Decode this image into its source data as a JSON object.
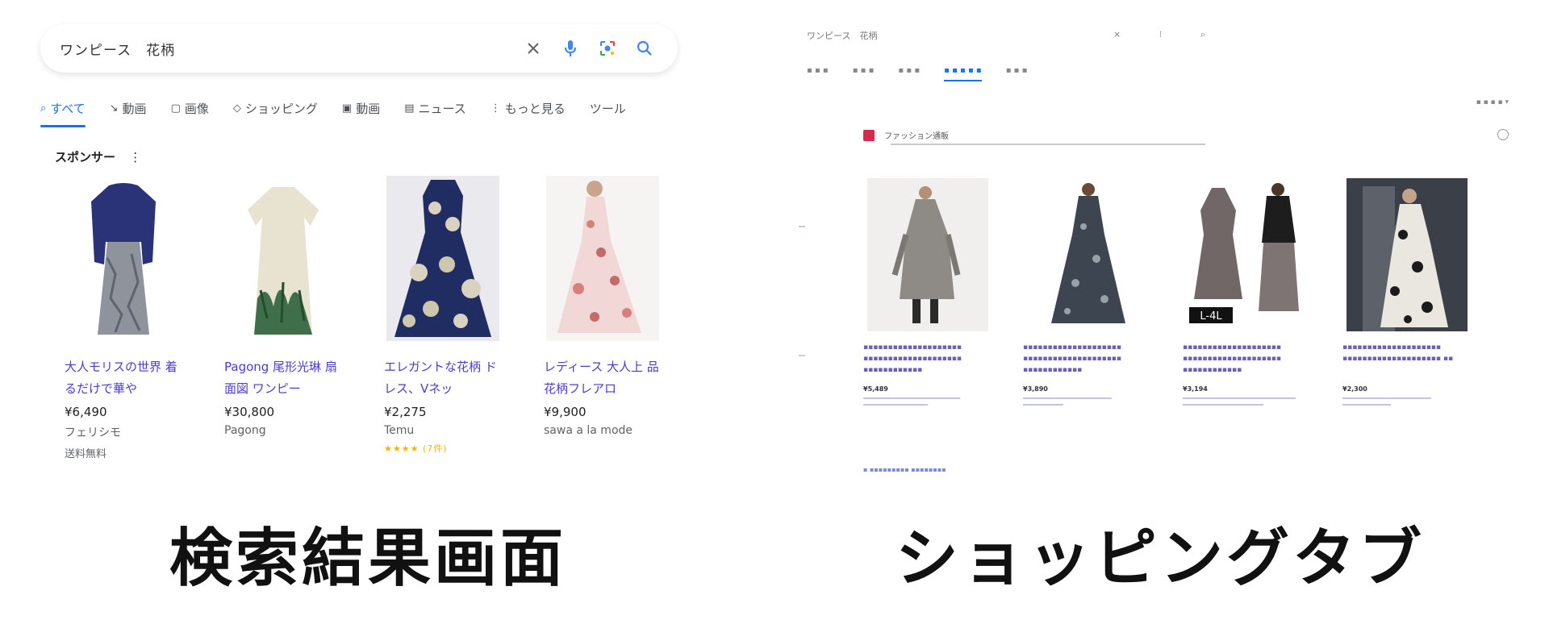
{
  "left": {
    "search_query": "ワンピース　花柄",
    "icons": [
      "close-icon",
      "mic-icon",
      "lens-icon",
      "search-icon"
    ],
    "tabs": [
      {
        "icon": "search-icon",
        "label": "すべて",
        "active": true
      },
      {
        "icon": "arrow-icon",
        "label": "動画"
      },
      {
        "icon": "image-icon",
        "label": "画像"
      },
      {
        "icon": "tag-icon",
        "label": "ショッピング"
      },
      {
        "icon": "play-icon",
        "label": "動画"
      },
      {
        "icon": "news-icon",
        "label": "ニュース"
      },
      {
        "icon": "more-icon",
        "label": "もっと見る"
      },
      {
        "icon": "",
        "label": "ツール"
      }
    ],
    "section_label": "スポンサー",
    "section_label_suffix": "⋮",
    "products": [
      {
        "title": "大人モリスの世界 着るだけで華や",
        "price": "¥6,490",
        "store": "フェリシモ",
        "extra": "送料無料",
        "palette": "navy-gray"
      },
      {
        "title": "Pagong 尾形光琳 扇面図 ワンピー",
        "price": "¥30,800",
        "store": "Pagong",
        "extra": "",
        "palette": "cream-green"
      },
      {
        "title": "エレガントな花柄 ドレス、Vネッ",
        "price": "¥2,275",
        "store": "Temu",
        "extra": "★★★★ (7件)",
        "palette": "navy-floral"
      },
      {
        "title": "レディース 大人上 品 花柄フレアロ",
        "price": "¥9,900",
        "store": "sawa a la mode",
        "extra": "",
        "palette": "pink-floral"
      }
    ]
  },
  "right": {
    "store_name": "ファッション通販",
    "badge": "L-4L",
    "items": [
      {
        "price": "¥5,489"
      },
      {
        "price": "¥3,890"
      },
      {
        "price": "¥3,194"
      },
      {
        "price": "¥2,300"
      }
    ]
  },
  "captions": {
    "left": "検索結果画面",
    "right": "ショッピングタブ"
  },
  "colors": {
    "accent": "#1a73e8",
    "link": "#4b3bd1",
    "star": "#f4b400",
    "store_logo": "#d62a4f"
  }
}
